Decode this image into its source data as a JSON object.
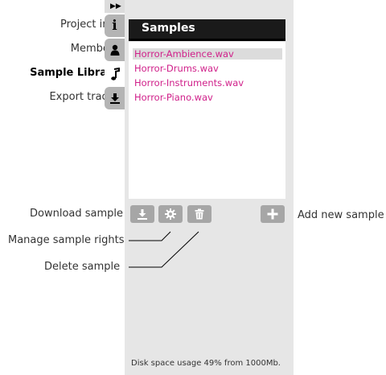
{
  "nav_labels": {
    "project_info": "Project info",
    "members": "Members",
    "sample_library": "Sample Library",
    "export_tracks": "Export tracks"
  },
  "panel": {
    "title": "Samples",
    "files": [
      "Horror-Ambience.wav",
      "Horror-Drums.wav",
      "Horror-Instruments.wav",
      "Horror-Piano.wav"
    ],
    "selected_index": 0
  },
  "callouts": {
    "download": "Download sample",
    "manage": "Manage sample rights",
    "delete": "Delete sample",
    "add": "Add new sample"
  },
  "footer": "Disk space usage 49% from 1000Mb.",
  "icons": {
    "collapse": "double-chevron-right-icon",
    "info": "info-icon",
    "members": "person-icon",
    "library": "music-note-icon",
    "export": "download-tray-icon"
  },
  "colors": {
    "file_text": "#d0208a",
    "header_bg": "#1a1a1a",
    "panel_bg": "#e6e6e6",
    "tab_bg": "#b4b4b4",
    "button_bg": "#a6a6a6"
  }
}
